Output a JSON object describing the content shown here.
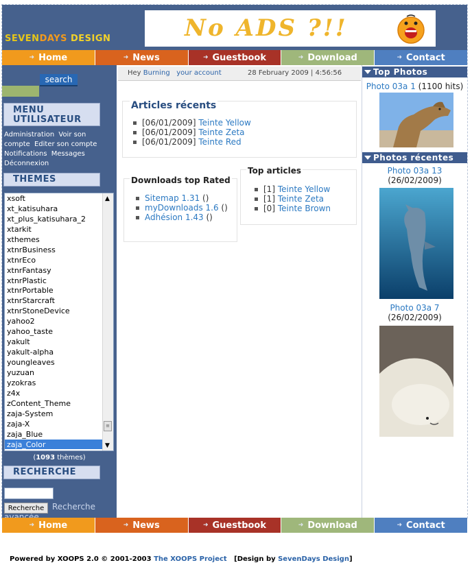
{
  "header": {
    "logo": {
      "part1": "SEVEN",
      "part2": "DAYS",
      "part3": " DESIGN"
    },
    "banner_text": "No ADS ?!!"
  },
  "nav": {
    "items": [
      {
        "label": "Home",
        "color": "#f19a1d"
      },
      {
        "label": "News",
        "color": "#d9631e"
      },
      {
        "label": "Guestbook",
        "color": "#a83227"
      },
      {
        "label": "Download",
        "color": "#9fb77b"
      },
      {
        "label": "Contact",
        "color": "#4f7fc0"
      }
    ]
  },
  "sidebar": {
    "search_button": "search",
    "menu_title": "MENU UTILISATEUR",
    "menu_items": [
      "Administration",
      "Voir son compte",
      "Editer son compte",
      "Notifications",
      "Messages",
      "Déconnexion"
    ],
    "themes_title": "THEMES",
    "themes": [
      "xsoft",
      "xt_katisuhara",
      "xt_plus_katisuhara_2",
      "xtarkit",
      "xthemes",
      "xtnrBusiness",
      "xtnrEco",
      "xtnrFantasy",
      "xtnrPlastic",
      "xtnrPortable",
      "xtnrStarcraft",
      "xtnrStoneDevice",
      "yahoo2",
      "yahoo_taste",
      "yakult",
      "yakult-alpha",
      "youngleaves",
      "yuzuan",
      "yzokras",
      "z4x",
      "zContent_Theme",
      "zaja-System",
      "zaja-X",
      "zaja_Blue",
      "zaja_Color"
    ],
    "selected_theme": "zaja_Color",
    "theme_count_open": "(",
    "theme_count_num": "1093",
    "theme_count_close": " thèmes)",
    "recherche_title": "RECHERCHE",
    "recherche_button": "Recherche",
    "recherche_link": "Recherche avancée"
  },
  "info_bar": {
    "greeting": "Hey",
    "user": "Burning",
    "account_link": "your account",
    "date": "28 February 2009 | 4:56:56"
  },
  "articles_recents": {
    "title": "Articles récents",
    "items": [
      {
        "date": "[06/01/2009]",
        "title": "Teinte Yellow"
      },
      {
        "date": "[06/01/2009]",
        "title": "Teinte Zeta"
      },
      {
        "date": "[06/01/2009]",
        "title": "Teinte Red"
      }
    ]
  },
  "downloads": {
    "title": "Downloads top Rated",
    "items": [
      {
        "name": "Sitemap 1.31",
        "suffix": " ()"
      },
      {
        "name": "myDownloads 1.6",
        "suffix": " ()"
      },
      {
        "name": "Adhésion 1.43",
        "suffix": " ()"
      }
    ]
  },
  "top_articles": {
    "title": "Top articles",
    "items": [
      {
        "rank": "[1]",
        "title": "Teinte Yellow"
      },
      {
        "rank": "[1]",
        "title": "Teinte Zeta"
      },
      {
        "rank": "[0]",
        "title": "Teinte Brown"
      }
    ]
  },
  "top_photos": {
    "title": "Top Photos",
    "item": {
      "title": "Photo 03a 1",
      "hits": " (1100 hits)"
    }
  },
  "recent_photos": {
    "title": "Photos récentes",
    "items": [
      {
        "title": "Photo 03a 13",
        "date": " (26/02/2009)"
      },
      {
        "title": "Photo 03a 7",
        "date": " (26/02/2009)"
      }
    ]
  },
  "footer": {
    "powered": "Powered by XOOPS 2.0 © 2001-2003 ",
    "project_link": "The XOOPS Project",
    "design_open": "   [Design by ",
    "design_link": "SevenDays Design",
    "design_close": "]"
  }
}
